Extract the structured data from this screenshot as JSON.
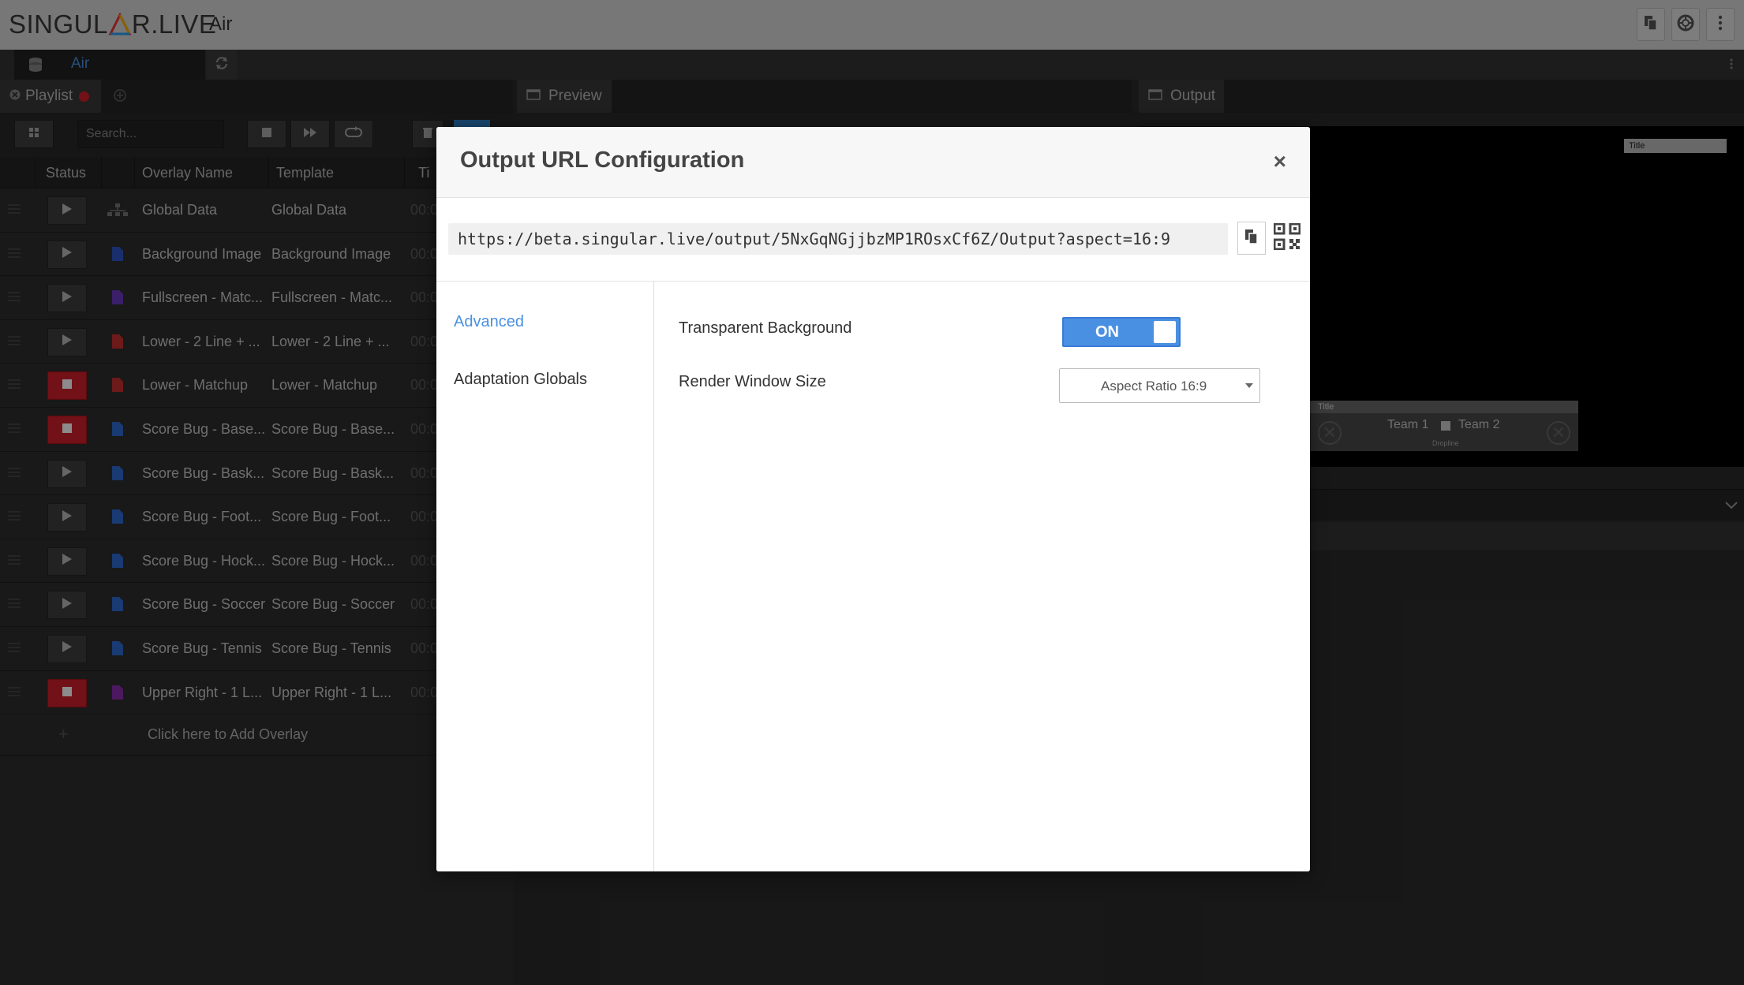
{
  "app": {
    "logo_text_left": "SINGUL",
    "logo_text_right": "R.LIVE",
    "title": "Air"
  },
  "tabs": {
    "doc_tab_label": "Air"
  },
  "panels": {
    "playlist_tab": "Playlist",
    "preview_tab": "Preview",
    "output_tab": "Output"
  },
  "playlist": {
    "search_placeholder": "Search...",
    "columns": [
      "Status",
      "Overlay Name",
      "Template",
      "Ti"
    ],
    "rows": [
      {
        "overlay": "Global Data",
        "template": "Global Data",
        "time": "00:0",
        "live": false,
        "icon": "data-node-icon",
        "icon_color": "#777777"
      },
      {
        "overlay": "Background Image",
        "template": "Background Image",
        "time": "00:0",
        "live": false,
        "icon": "file-icon",
        "icon_color": "#2f57c6"
      },
      {
        "overlay": "Fullscreen - Matc...",
        "template": "Fullscreen - Matc...",
        "time": "00:0",
        "live": false,
        "icon": "file-icon",
        "icon_color": "#6a3ac0"
      },
      {
        "overlay": "Lower - 2 Line + ...",
        "template": "Lower - 2 Line + ...",
        "time": "00:0",
        "live": false,
        "icon": "file-icon",
        "icon_color": "#c63030"
      },
      {
        "overlay": "Lower - Matchup",
        "template": "Lower - Matchup",
        "time": "00:0",
        "live": true,
        "icon": "file-icon",
        "icon_color": "#c63030"
      },
      {
        "overlay": "Score Bug - Base...",
        "template": "Score Bug - Base...",
        "time": "00:0",
        "live": true,
        "icon": "file-icon",
        "icon_color": "#2f6ad0"
      },
      {
        "overlay": "Score Bug - Bask...",
        "template": "Score Bug - Bask...",
        "time": "00:0",
        "live": false,
        "icon": "file-icon",
        "icon_color": "#2f6ad0"
      },
      {
        "overlay": "Score Bug - Foot...",
        "template": "Score Bug - Foot...",
        "time": "00:0",
        "live": false,
        "icon": "file-icon",
        "icon_color": "#2f6ad0"
      },
      {
        "overlay": "Score Bug - Hock...",
        "template": "Score Bug - Hock...",
        "time": "00:0",
        "live": false,
        "icon": "file-icon",
        "icon_color": "#2f6ad0"
      },
      {
        "overlay": "Score Bug - Soccer",
        "template": "Score Bug - Soccer",
        "time": "00:0",
        "live": false,
        "icon": "file-icon",
        "icon_color": "#2f6ad0"
      },
      {
        "overlay": "Score Bug - Tennis",
        "template": "Score Bug - Tennis",
        "time": "00:0",
        "live": false,
        "icon": "file-icon",
        "icon_color": "#2f6ad0"
      },
      {
        "overlay": "Upper Right - 1 L...",
        "template": "Upper Right - 1 L...",
        "time": "00:0",
        "live": true,
        "icon": "file-icon",
        "icon_color": "#8a2fb0"
      }
    ],
    "add_overlay_label": "Click here to Add Overlay"
  },
  "output_preview": {
    "mini_title": "Title",
    "bug_title": "Title",
    "team1": "Team 1",
    "team2": "Team 2",
    "bug_subtext": "Dropline"
  },
  "modal": {
    "title": "Output URL Configuration",
    "close_symbol": "×",
    "url": "https://beta.singular.live/output/5NxGqNGjjbzMP1ROsxCf6Z/Output?aspect=16:9",
    "sidebar": [
      {
        "label": "Advanced",
        "active": true
      },
      {
        "label": "Adaptation Globals",
        "active": false
      }
    ],
    "transparent_label": "Transparent Background",
    "toggle_state": "ON",
    "render_label": "Render Window Size",
    "render_value": "Aspect Ratio 16:9"
  },
  "colors": {
    "accent": "#4a90e2",
    "live": "#d0202a"
  }
}
